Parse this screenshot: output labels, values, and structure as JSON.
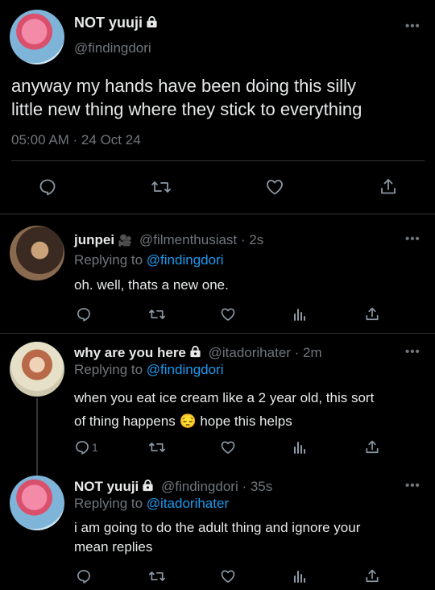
{
  "main_tweet": {
    "name": "NOT yuuji",
    "handle": "@findingdori",
    "text_line1": "anyway my hands have been doing this silly",
    "text_line2": "little new thing where they stick to everything",
    "timestamp": "05:00 AM · 24 Oct 24"
  },
  "replies": [
    {
      "name": "junpei",
      "name_emoji": "🎥",
      "handle": "@filmenthusiast",
      "time": "· 2s",
      "replying_label": "Replying to",
      "replying_to": "@findingdori",
      "text": "oh. well, thats a new one."
    },
    {
      "name": "why are you here",
      "handle": "@itadorihater",
      "time": "· 2m",
      "replying_label": "Replying to",
      "replying_to": "@findingdori",
      "text_line1": "when you eat ice cream like a 2 year old, this sort",
      "text_line2": "of thing happens 😔  hope this helps",
      "reply_count": "1"
    },
    {
      "name": "NOT yuuji",
      "handle": "@findingdori",
      "time": "· 35s",
      "replying_label": "Replying to",
      "replying_to": "@itadorihater",
      "text_line1": "i am going to do the adult thing and ignore your",
      "text_line2": "mean replies"
    }
  ],
  "colors": {
    "background": "#000000",
    "text": "#e7e9ea",
    "muted": "#71767b",
    "link": "#1d9bf0",
    "divider": "#2f3336"
  },
  "icons": [
    "reply-icon",
    "retweet-icon",
    "like-icon",
    "share-icon",
    "views-icon",
    "lock-icon",
    "more-icon"
  ]
}
